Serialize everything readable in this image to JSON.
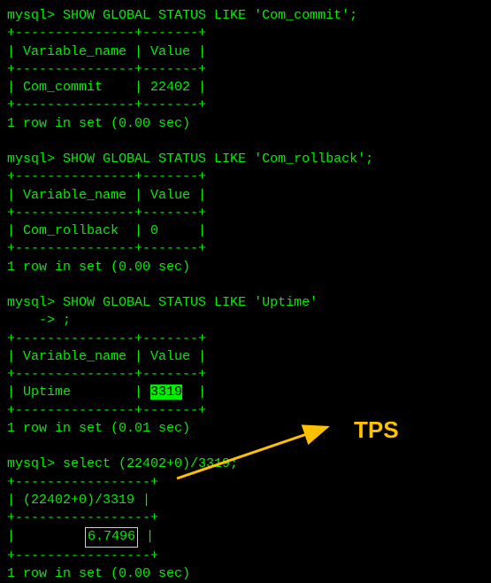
{
  "prompt": "mysql>",
  "continuation_prompt": "    ->",
  "queries": [
    {
      "sql": "SHOW GLOBAL STATUS LIKE 'Com_commit';",
      "border_top": "+---------------+-------+",
      "header_row": "| Variable_name | Value |",
      "border_mid": "+---------------+-------+",
      "data_row_prefix": "| Com_commit    | ",
      "data_value": "22402",
      "data_row_suffix": " |",
      "border_bot": "+---------------+-------+",
      "footer": "1 row in set (0.00 sec)"
    },
    {
      "sql": "SHOW GLOBAL STATUS LIKE 'Com_rollback';",
      "border_top": "+---------------+-------+",
      "header_row": "| Variable_name | Value |",
      "border_mid": "+---------------+-------+",
      "data_row_prefix": "| Com_rollback  | ",
      "data_value": "0",
      "data_row_suffix": "     |",
      "border_bot": "+---------------+-------+",
      "footer": "1 row in set (0.00 sec)"
    },
    {
      "sql": "SHOW GLOBAL STATUS LIKE 'Uptime'",
      "sql_cont": ";",
      "border_top": "+---------------+-------+",
      "header_row": "| Variable_name | Value |",
      "border_mid": "+---------------+-------+",
      "data_row_prefix": "| Uptime        | ",
      "data_value": "3319",
      "data_row_suffix": "  |",
      "border_bot": "+---------------+-------+",
      "footer": "1 row in set (0.01 sec)",
      "value_highlighted": true
    },
    {
      "sql": "select (22402+0)/3319;",
      "border_top": "+-----------------+",
      "header_row": "| (22402+0)/3319 |",
      "border_mid": "+-----------------+",
      "data_row_prefix": "|         ",
      "data_value": "6.7496",
      "data_row_suffix": " |",
      "border_bot": "+-----------------+",
      "footer": "1 row in set (0.00 sec)",
      "value_boxed": true
    }
  ],
  "annotation": {
    "label": "TPS"
  },
  "chart_data": {
    "type": "table",
    "title": "MySQL TPS calculation from global status",
    "tables": [
      {
        "Variable_name": "Com_commit",
        "Value": 22402
      },
      {
        "Variable_name": "Com_rollback",
        "Value": 0
      },
      {
        "Variable_name": "Uptime",
        "Value": 3319
      }
    ],
    "computation": {
      "expression": "(22402+0)/3319",
      "result": 6.7496,
      "label": "TPS"
    }
  }
}
